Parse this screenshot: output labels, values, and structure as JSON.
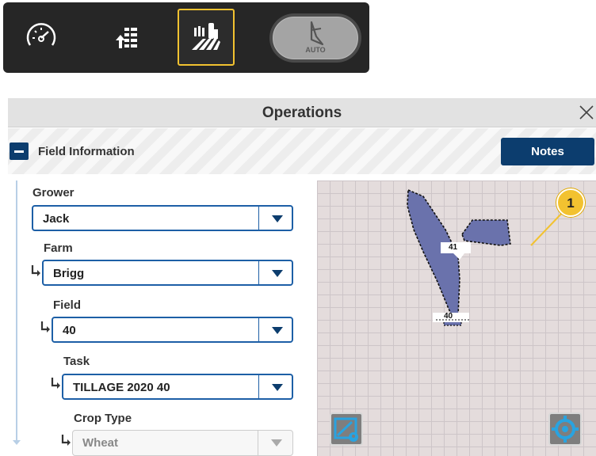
{
  "toolbar": {
    "buttons": [
      {
        "icon": "speedometer-icon"
      },
      {
        "icon": "layers-upload-icon"
      },
      {
        "icon": "field-operations-icon",
        "selected": true
      },
      {
        "icon": "auto-steer-icon",
        "label": "AUTO"
      }
    ],
    "selected_color": "#f2c230"
  },
  "dialog": {
    "title": "Operations",
    "close_icon": "close-icon"
  },
  "field_info": {
    "section_label": "Field Information",
    "notes_label": "Notes",
    "accent_color": "#0c3d6e"
  },
  "form": {
    "grower": {
      "label": "Grower",
      "value": "Jack"
    },
    "farm": {
      "label": "Farm",
      "value": "Brigg"
    },
    "field": {
      "label": "Field",
      "value": "40"
    },
    "task": {
      "label": "Task",
      "value": "TILLAGE 2020 40"
    },
    "crop_type": {
      "label": "Crop Type",
      "value": "Wheat",
      "disabled": true
    }
  },
  "map": {
    "field_labels": [
      "41",
      "40"
    ],
    "callout_number": "1",
    "boundary_fill": "#6a72ac",
    "buttons": [
      {
        "icon": "edit-boundary-icon"
      },
      {
        "icon": "locate-icon"
      }
    ]
  }
}
